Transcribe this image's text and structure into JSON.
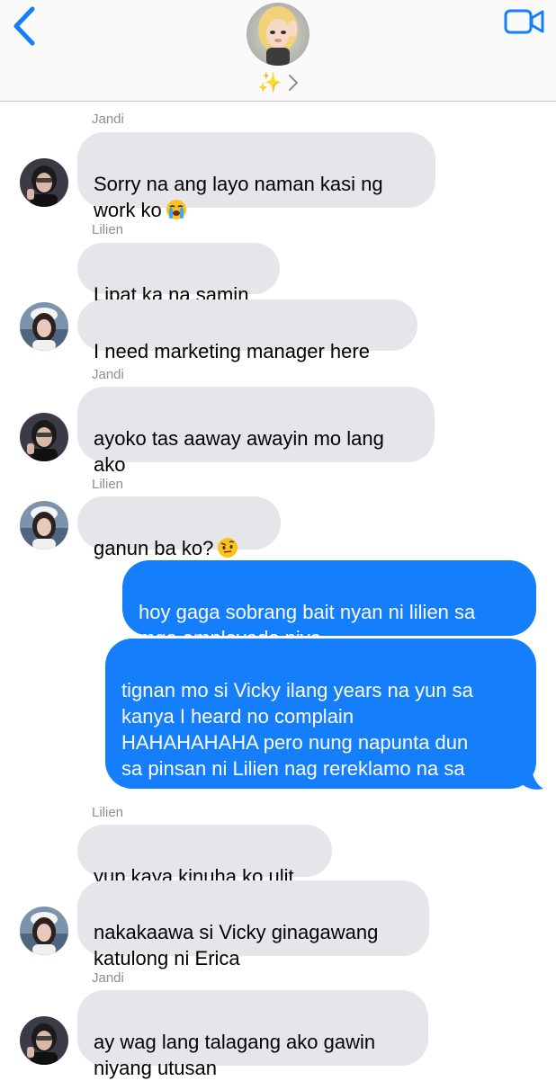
{
  "header": {
    "group_name": "✨",
    "icons": {
      "back": "chevron-left-icon",
      "video": "video-camera-icon",
      "chevron": "chevron-right-icon"
    }
  },
  "colors": {
    "accent": "#147efb",
    "incoming_bubble": "#e5e5ea",
    "sender_label": "#8e8e93"
  },
  "messages": [
    {
      "sender": "Jandi",
      "text": "Sorry na ang layo naman kasi ng\nwork ko",
      "emoji": "loudly-crying-face"
    },
    {
      "sender": "Lilien",
      "text": "Lipat ka na samin"
    },
    {
      "text": "I need marketing manager here"
    },
    {
      "sender": "Jandi",
      "text": "ayoko tas aaway awayin mo lang\nako"
    },
    {
      "sender": "Lilien",
      "text": "ganun ba ko?",
      "emoji": "raised-eyebrow-face"
    },
    {
      "text": "hoy gaga sobrang bait nyan ni lilien sa\nmga empleyado niya"
    },
    {
      "text": "tignan mo si Vicky ilang years na yun sa\nkanya I heard no complain\nHAHAHAHAHA pero nung napunta dun\nsa pinsan ni Lilien nag rereklamo na sa\nkanya"
    },
    {
      "sender": "Lilien",
      "text": "yup kaya kinuha ko ulit"
    },
    {
      "text": "nakakaawa si Vicky ginagawang\nkatulong ni Erica"
    },
    {
      "sender": "Jandi",
      "text": "ay wag lang talagang ako gawin\nniyang utusan"
    }
  ]
}
